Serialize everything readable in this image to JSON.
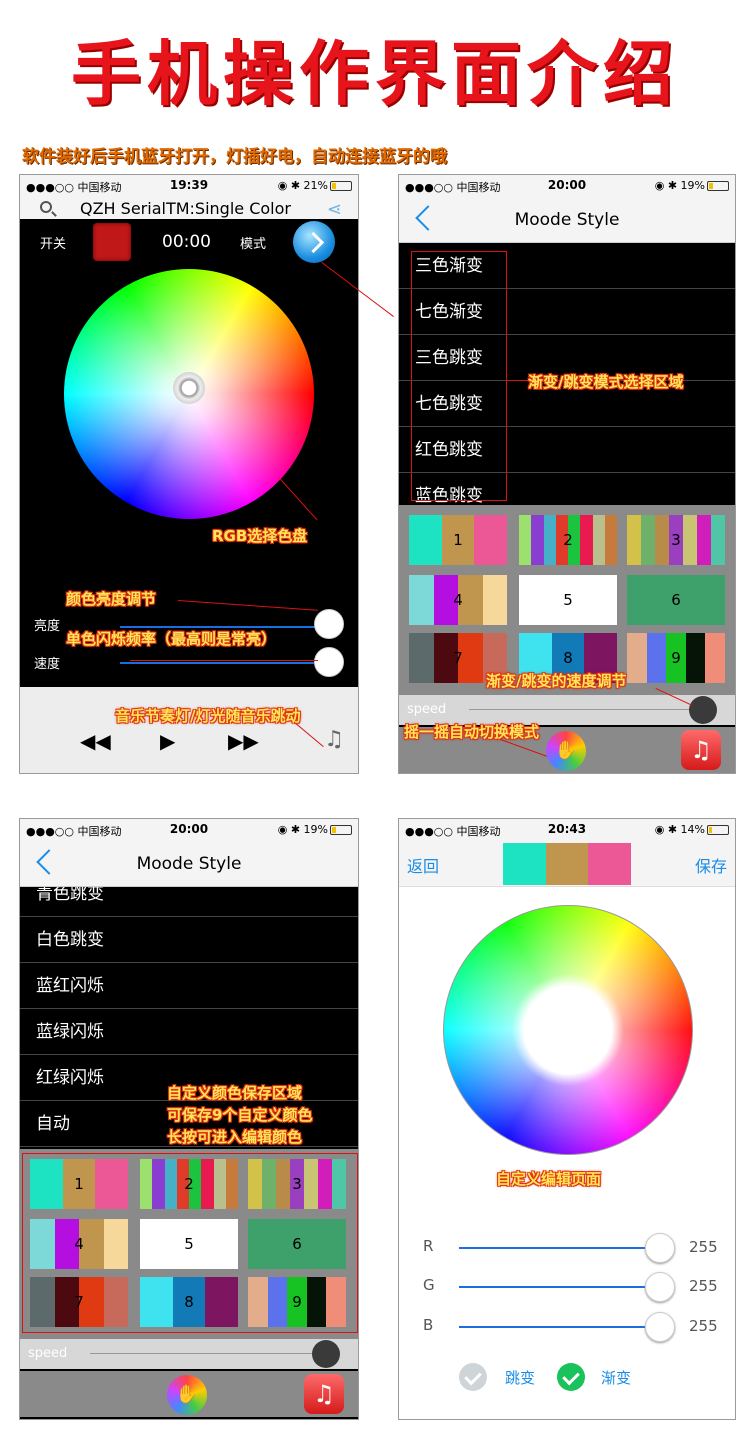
{
  "title": "手机操作界面介绍",
  "intro": "软件装好后手机蓝牙打开，灯插好电，自动连接蓝牙的哦",
  "phone1": {
    "status": {
      "carrier": "●●●○○ 中国移动 ",
      "time": "19:39",
      "right": "◉ ✱ 21%",
      "battery_level": 0.21
    },
    "header_title": "QZH SerialTM:Single Color",
    "switch_label": "开关",
    "timer": "00:00",
    "mode_label": "模式",
    "brightness_label": "亮度",
    "speed_label": "速度",
    "player": {
      "prev": "◀◀",
      "play": "▶",
      "next": "▶▶",
      "music_list": "♫"
    }
  },
  "phone2": {
    "status": {
      "carrier": "●●●○○ 中国移动 ",
      "time": "20:00",
      "right": "◉ ✱ 19%",
      "battery_level": 0.19
    },
    "nav_title": "Moode Style",
    "modes": [
      "三色渐变",
      "七色渐变",
      "三色跳变",
      "七色跳变",
      "红色跳变",
      "蓝色跳变"
    ],
    "speed_label": "speed"
  },
  "phone3": {
    "status": {
      "carrier": "●●●○○ 中国移动 ",
      "time": "20:00",
      "right": "◉ ✱ 19%",
      "battery_level": 0.19
    },
    "nav_title": "Moode Style",
    "modes": [
      "青色跳变",
      "白色跳变",
      "蓝红闪烁",
      "蓝绿闪烁",
      "红绿闪烁",
      "自动"
    ],
    "speed_label": "speed"
  },
  "phone4": {
    "status": {
      "carrier": "●●●○○ 中国移动 ",
      "time": "20:43",
      "right": "◉ ✱ 14%",
      "battery_level": 0.14
    },
    "back": "返回",
    "save": "保存",
    "preview_colors": [
      "#1de3c3",
      "#c0954e",
      "#ec5895"
    ],
    "channels": [
      {
        "name": "R",
        "value": "255"
      },
      {
        "name": "G",
        "value": "255"
      },
      {
        "name": "B",
        "value": "255"
      }
    ],
    "options": {
      "jump": "跳变",
      "fade": "渐变"
    }
  },
  "swatches": [
    {
      "num": "1",
      "colors": [
        "#1de3c3",
        "#c0954e",
        "#ec5895"
      ]
    },
    {
      "num": "2",
      "colors": [
        "#9ce06d",
        "#8a3ed1",
        "#46b0c7",
        "#e03a2a",
        "#1ac43e",
        "#e81a4f",
        "#b9c08d",
        "#c67a3c"
      ]
    },
    {
      "num": "3",
      "colors": [
        "#d3c24a",
        "#6fb06a",
        "#b98b49",
        "#9a3fbf",
        "#c8c474",
        "#d11db9",
        "#4fc6a5"
      ]
    },
    {
      "num": "4",
      "colors": [
        "#7dd8d8",
        "#b40ee0",
        "#c0954e",
        "#f6d89a"
      ]
    },
    {
      "num": "5",
      "colors": [
        "#ffffff"
      ]
    },
    {
      "num": "6",
      "colors": [
        "#3ea06a"
      ]
    },
    {
      "num": "7",
      "colors": [
        "#5d6a6b",
        "#4d0910",
        "#e03a12",
        "#c86a5b"
      ]
    },
    {
      "num": "8",
      "colors": [
        "#3ee3ef",
        "#137ab8",
        "#7d1560"
      ]
    },
    {
      "num": "9",
      "colors": [
        "#e3ad8c",
        "#5b72ec",
        "#17c223",
        "#051407",
        "#f08d79"
      ]
    }
  ],
  "annotations": {
    "wheel": "RGB选择色盘",
    "brightness": "颜色亮度调节",
    "flash": "单色闪烁频率（最高则是常亮）",
    "music": "音乐节奏灯/灯光随音乐跳动",
    "mode_area": "渐变/跳变模式选择区域",
    "speed": "渐变/跳变的速度调节",
    "shake": "摇一摇自动切换模式",
    "custom1": "自定义颜色保存区域",
    "custom2": "可保存9个自定义颜色",
    "custom3": "长按可进入编辑颜色",
    "edit_page": "自定义编辑页面"
  },
  "colors": {
    "accent": "#1a8ce6",
    "annotation_text": "#ffe55a",
    "annotation_outline": "#e2340e",
    "title": "#e8141b"
  }
}
